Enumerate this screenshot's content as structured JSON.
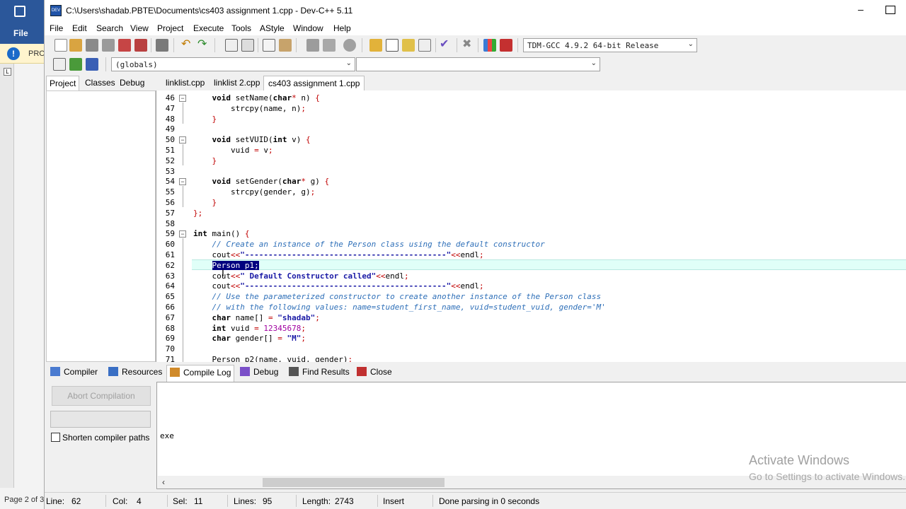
{
  "background_app": {
    "file_tab": "File",
    "protected_label": "PRO",
    "page_indicator": "Page 2 of 3"
  },
  "window": {
    "title": "C:\\Users\\shadab.PBTE\\Documents\\cs403 assignment 1.cpp - Dev-C++ 5.11",
    "icon_text": "DEV"
  },
  "menu": [
    "File",
    "Edit",
    "Search",
    "View",
    "Project",
    "Execute",
    "Tools",
    "AStyle",
    "Window",
    "Help"
  ],
  "toolbar": {
    "compiler_select": "TDM-GCC 4.9.2 64-bit Release",
    "scope_select": "(globals)",
    "member_select": ""
  },
  "left_tabs": [
    "Project",
    "Classes",
    "Debug"
  ],
  "editor_tabs": [
    "linklist.cpp",
    "linklist 2.cpp",
    "cs403 assignment 1.cpp"
  ],
  "active_editor_tab": "cs403 assignment 1.cpp",
  "code_lines": [
    {
      "n": "46",
      "fold": "minus",
      "html": "    <span class=\"kw\">void</span> setName(<span class=\"kw\">char</span><span class=\"sym\">*</span> n) <span class=\"sym\">{</span>"
    },
    {
      "n": "47",
      "html": "        strcpy(name, n)<span class=\"sym\">;</span>"
    },
    {
      "n": "48",
      "html": "    <span class=\"sym\">}</span>"
    },
    {
      "n": "49",
      "html": ""
    },
    {
      "n": "50",
      "fold": "minus",
      "html": "    <span class=\"kw\">void</span> setVUID(<span class=\"kw\">int</span> v) <span class=\"sym\">{</span>"
    },
    {
      "n": "51",
      "html": "        vuid <span class=\"sym\">=</span> v<span class=\"sym\">;</span>"
    },
    {
      "n": "52",
      "html": "    <span class=\"sym\">}</span>"
    },
    {
      "n": "53",
      "html": ""
    },
    {
      "n": "54",
      "fold": "minus",
      "html": "    <span class=\"kw\">void</span> setGender(<span class=\"kw\">char</span><span class=\"sym\">*</span> g) <span class=\"sym\">{</span>"
    },
    {
      "n": "55",
      "html": "        strcpy(gender, g)<span class=\"sym\">;</span>"
    },
    {
      "n": "56",
      "html": "    <span class=\"sym\">}</span>"
    },
    {
      "n": "57",
      "html": "<span class=\"sym\">};</span>"
    },
    {
      "n": "58",
      "html": ""
    },
    {
      "n": "59",
      "fold": "minus",
      "html": "<span class=\"kw\">int</span> main() <span class=\"sym\">{</span>"
    },
    {
      "n": "60",
      "html": "    <span class=\"cm\">// Create an instance of the Person class using the default constructor</span>"
    },
    {
      "n": "61",
      "html": "    cout<span class=\"sym\">&lt;&lt;</span><span class=\"str\">\"-------------------------------------------\"</span><span class=\"sym\">&lt;&lt;</span>endl<span class=\"sym\">;</span>"
    },
    {
      "n": "62",
      "html": "    <span class=\"sel\">Person p1;</span>"
    },
    {
      "n": "63",
      "html": "    cout<span class=\"sym\">&lt;&lt;</span><span class=\"str\">\" Default Constructor called\"</span><span class=\"sym\">&lt;&lt;</span>endl<span class=\"sym\">;</span>"
    },
    {
      "n": "64",
      "html": "    cout<span class=\"sym\">&lt;&lt;</span><span class=\"str\">\"-------------------------------------------\"</span><span class=\"sym\">&lt;&lt;</span>endl<span class=\"sym\">;</span>"
    },
    {
      "n": "65",
      "html": "    <span class=\"cm\">// Use the parameterized constructor to create another instance of the Person class</span>"
    },
    {
      "n": "66",
      "html": "    <span class=\"cm\">// with the following values: name=student_first_name, vuid=student_vuid, gender='M'</span>"
    },
    {
      "n": "67",
      "html": "    <span class=\"kw\">char</span> name[] <span class=\"sym\">=</span> <span class=\"str\">\"shadab\"</span><span class=\"sym\">;</span>"
    },
    {
      "n": "68",
      "html": "    <span class=\"kw\">int</span> vuid <span class=\"sym\">=</span> <span class=\"num\">12345678</span><span class=\"sym\">;</span>"
    },
    {
      "n": "69",
      "html": "    <span class=\"kw\">char</span> gender[] <span class=\"sym\">=</span> <span class=\"str\">\"M\"</span><span class=\"sym\">;</span>"
    },
    {
      "n": "70",
      "html": ""
    },
    {
      "n": "71",
      "html": "    Person p2(name, vuid, gender)<span class=\"sym\">;</span>"
    }
  ],
  "bottom_tabs": [
    {
      "label": "Compiler",
      "icon": "compiler-icon",
      "color": "#4a7bd0"
    },
    {
      "label": "Resources",
      "icon": "resources-icon",
      "color": "#3a6fc4"
    },
    {
      "label": "Compile Log",
      "icon": "compile-log-icon",
      "color": "#d08a2a"
    },
    {
      "label": "Debug",
      "icon": "debug-icon",
      "color": "#7a4fc8"
    },
    {
      "label": "Find Results",
      "icon": "find-results-icon",
      "color": "#555555"
    },
    {
      "label": "Close",
      "icon": "close-icon",
      "color": "#c03030"
    }
  ],
  "compile_panel": {
    "abort_button": "Abort Compilation",
    "shorten_paths_label": "Shorten compiler paths",
    "log_text": "exe"
  },
  "watermark": {
    "line1": "Activate Windows",
    "line2": "Go to Settings to activate Windows."
  },
  "status": {
    "line_label": "Line:",
    "line_value": "62",
    "col_label": "Col:",
    "col_value": "4",
    "sel_label": "Sel:",
    "sel_value": "11",
    "lines_label": "Lines:",
    "lines_value": "95",
    "length_label": "Length:",
    "length_value": "2743",
    "mode": "Insert",
    "message": "Done parsing in 0 seconds"
  }
}
